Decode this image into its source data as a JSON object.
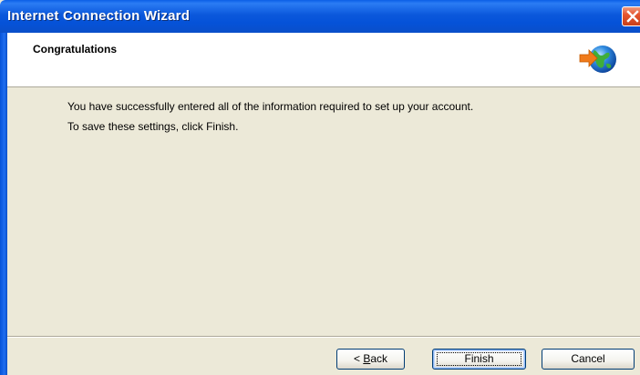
{
  "window": {
    "title": "Internet Connection Wizard",
    "close_icon": "close-icon"
  },
  "header": {
    "title": "Congratulations",
    "icon": "globe-arrow-icon"
  },
  "body": {
    "line1": "You have successfully entered all of the information required to set up your account.",
    "line2": "To save these settings, click Finish."
  },
  "buttons": {
    "back_label_prefix": "< ",
    "back_label_mnemonic": "B",
    "back_label_rest": "ack",
    "finish_label": "Finish",
    "cancel_label": "Cancel"
  },
  "colors": {
    "titlebar": "#0552d8",
    "dialog_bg": "#ece9d8",
    "close_button": "#e5552f"
  }
}
